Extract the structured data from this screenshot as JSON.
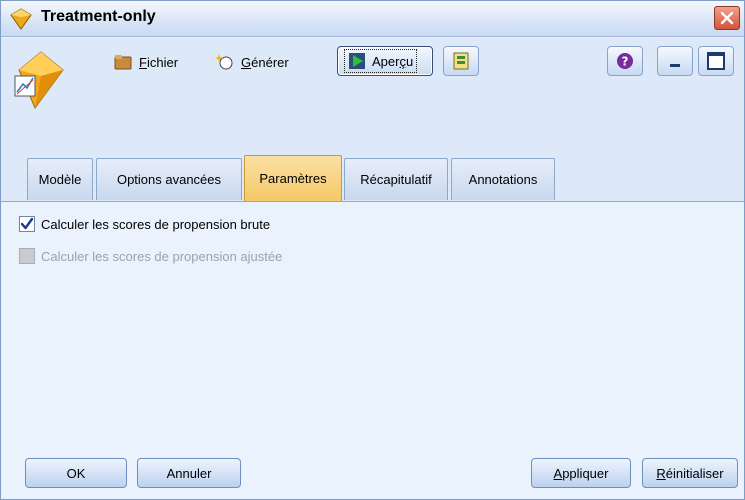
{
  "window": {
    "title": "Treatment-only"
  },
  "toolbar": {
    "fichier_prefix": "",
    "fichier_underline": "F",
    "fichier_rest": "ichier",
    "generer_underline": "G",
    "generer_rest": "énérer",
    "apercu_pre": "Aper",
    "apercu_underline": "ç",
    "apercu_rest": "u",
    "icons": [
      "folder-icon",
      "sparkle-icon",
      "play-icon",
      "export-icon",
      "help-icon",
      "minimize-icon",
      "maximize-icon",
      "close-icon"
    ]
  },
  "tabs": [
    {
      "label": "Modèle",
      "active": false
    },
    {
      "label": "Options avancées",
      "active": false
    },
    {
      "label": "Paramètres",
      "active": true
    },
    {
      "label": "Récapitulatif",
      "active": false
    },
    {
      "label": "Annotations",
      "active": false
    }
  ],
  "settings": {
    "raw_propensity": {
      "label": "Calculer les scores de propension brute",
      "checked": true,
      "enabled": true
    },
    "adjusted_propensity": {
      "label": "Calculer les scores de propension ajustée",
      "checked": false,
      "enabled": false
    }
  },
  "buttons": {
    "ok": "OK",
    "annuler": "Annuler",
    "appliquer_underline": "A",
    "appliquer_rest": "ppliquer",
    "reinit_underline": "R",
    "reinit_rest": "éinitialiser"
  },
  "colors": {
    "active_tab": "#f5c867",
    "window_bg": "#eaf2fd",
    "close": "#d5523a"
  }
}
